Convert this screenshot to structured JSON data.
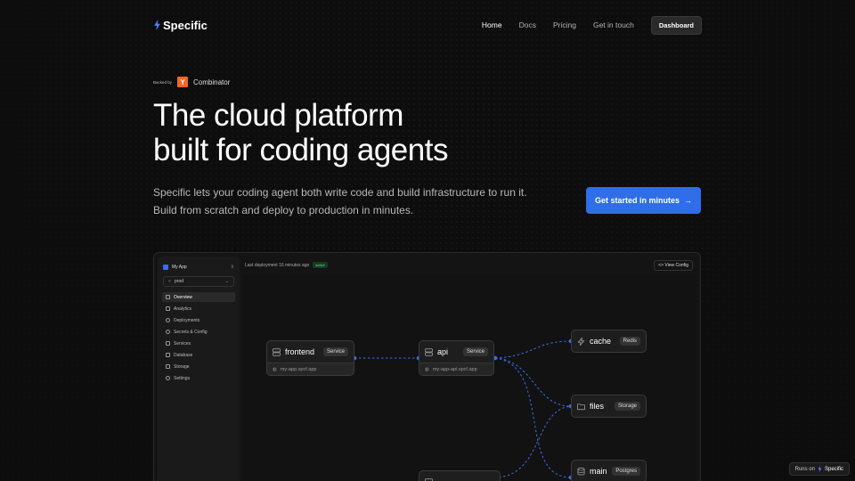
{
  "brand": {
    "name": "Specific"
  },
  "nav": {
    "links": [
      {
        "label": "Home",
        "active": true
      },
      {
        "label": "Docs"
      },
      {
        "label": "Pricing"
      },
      {
        "label": "Get in touch"
      }
    ],
    "dashboard_label": "Dashboard"
  },
  "hero": {
    "backed_label": "Backed by",
    "yc_letter": "Y",
    "yc_name": "Combinator",
    "title_line1": "The cloud platform",
    "title_line2": "built for coding agents",
    "subtitle_line1": "Specific lets your coding agent both write code and build infrastructure to run it.",
    "subtitle_line2": "Build from scratch and deploy to production in minutes.",
    "cta_label": "Get started in minutes",
    "cta_arrow": "→"
  },
  "app": {
    "app_name": "My App",
    "env": "prod",
    "menu": [
      {
        "label": "Overview",
        "icon": "grid-icon",
        "active": true
      },
      {
        "label": "Analytics",
        "icon": "chart-icon"
      },
      {
        "label": "Deployments",
        "icon": "rocket-icon"
      },
      {
        "label": "Secrets & Config",
        "icon": "key-icon"
      },
      {
        "label": "Services",
        "icon": "server-icon"
      },
      {
        "label": "Database",
        "icon": "database-icon"
      },
      {
        "label": "Storage",
        "icon": "storage-icon"
      },
      {
        "label": "Settings",
        "icon": "gear-icon"
      }
    ],
    "last_deploy": "Last deployment 16 minutes ago",
    "status": "active",
    "view_config": "<> View Config"
  },
  "nodes": {
    "frontend": {
      "name": "frontend",
      "type": "Service",
      "url": "my-app.spcf.app"
    },
    "api": {
      "name": "api",
      "type": "Service",
      "url": "my-app-api.spcf.app"
    },
    "cache": {
      "name": "cache",
      "type": "Redis"
    },
    "files": {
      "name": "files",
      "type": "Storage"
    },
    "main": {
      "name": "main",
      "type": "Postgres"
    }
  },
  "colors": {
    "accent": "#2f6ee8",
    "link": "#3b6ee8",
    "yc": "#f26625"
  },
  "footer": {
    "runs_on": "Runs on",
    "brand": "Specific"
  }
}
